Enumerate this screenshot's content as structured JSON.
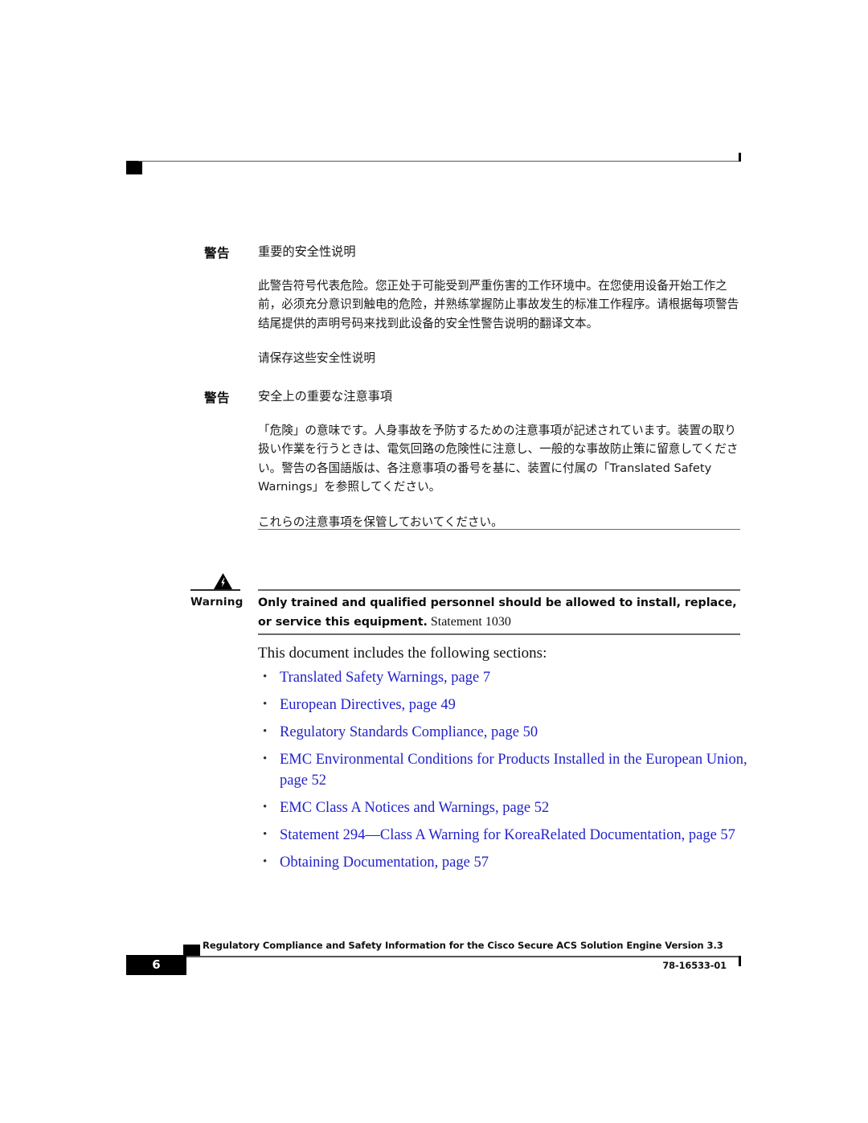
{
  "page": {
    "number": "6",
    "doc_id": "78-16533-01",
    "footer_title": "Regulatory Compliance and Safety Information for the Cisco Secure ACS Solution Engine Version 3.3"
  },
  "warnings": [
    {
      "label": "警告",
      "heading": "重要的安全性说明",
      "body": "此警告符号代表危险。您正处于可能受到严重伤害的工作环境中。在您使用设备开始工作之前，必须充分意识到触电的危险，并熟练掌握防止事故发生的标准工作程序。请根据每项警告结尾提供的声明号码来找到此设备的安全性警告说明的翻译文本。",
      "closing": "请保存这些安全性说明"
    },
    {
      "label": "警告",
      "heading": "安全上の重要な注意事項",
      "body": "「危険」の意味です。人身事故を予防するための注意事項が記述されています。装置の取り扱い作業を行うときは、電気回路の危険性に注意し、一般的な事故防止策に留意してください。警告の各国語版は、各注意事項の番号を基に、装置に付属の「Translated Safety Warnings」を参照してください。",
      "closing": "これらの注意事項を保管しておいてください。"
    }
  ],
  "english_warning": {
    "label": "Warning",
    "icon": "warning-triangle-lightning-icon",
    "text": "Only trained and qualified personnel should be allowed to install, replace, or service this equipment.",
    "statement": "Statement 1030"
  },
  "intro": "This document includes the following sections:",
  "links": [
    {
      "text": "Translated Safety Warnings, page 7"
    },
    {
      "text": "European Directives, page 49"
    },
    {
      "text": "Regulatory Standards Compliance, page 50"
    },
    {
      "text": "EMC Environmental Conditions for Products Installed in the European Union, page 52"
    },
    {
      "text": "EMC Class A Notices and Warnings, page 52"
    },
    {
      "text": "Statement 294—Class A Warning for KoreaRelated Documentation, page 57"
    },
    {
      "text": "Obtaining Documentation, page 57"
    }
  ],
  "bullet_glyph": "•",
  "colors": {
    "link": "#2222cc",
    "rule": "#6a6a6a",
    "ink": "#111111"
  }
}
